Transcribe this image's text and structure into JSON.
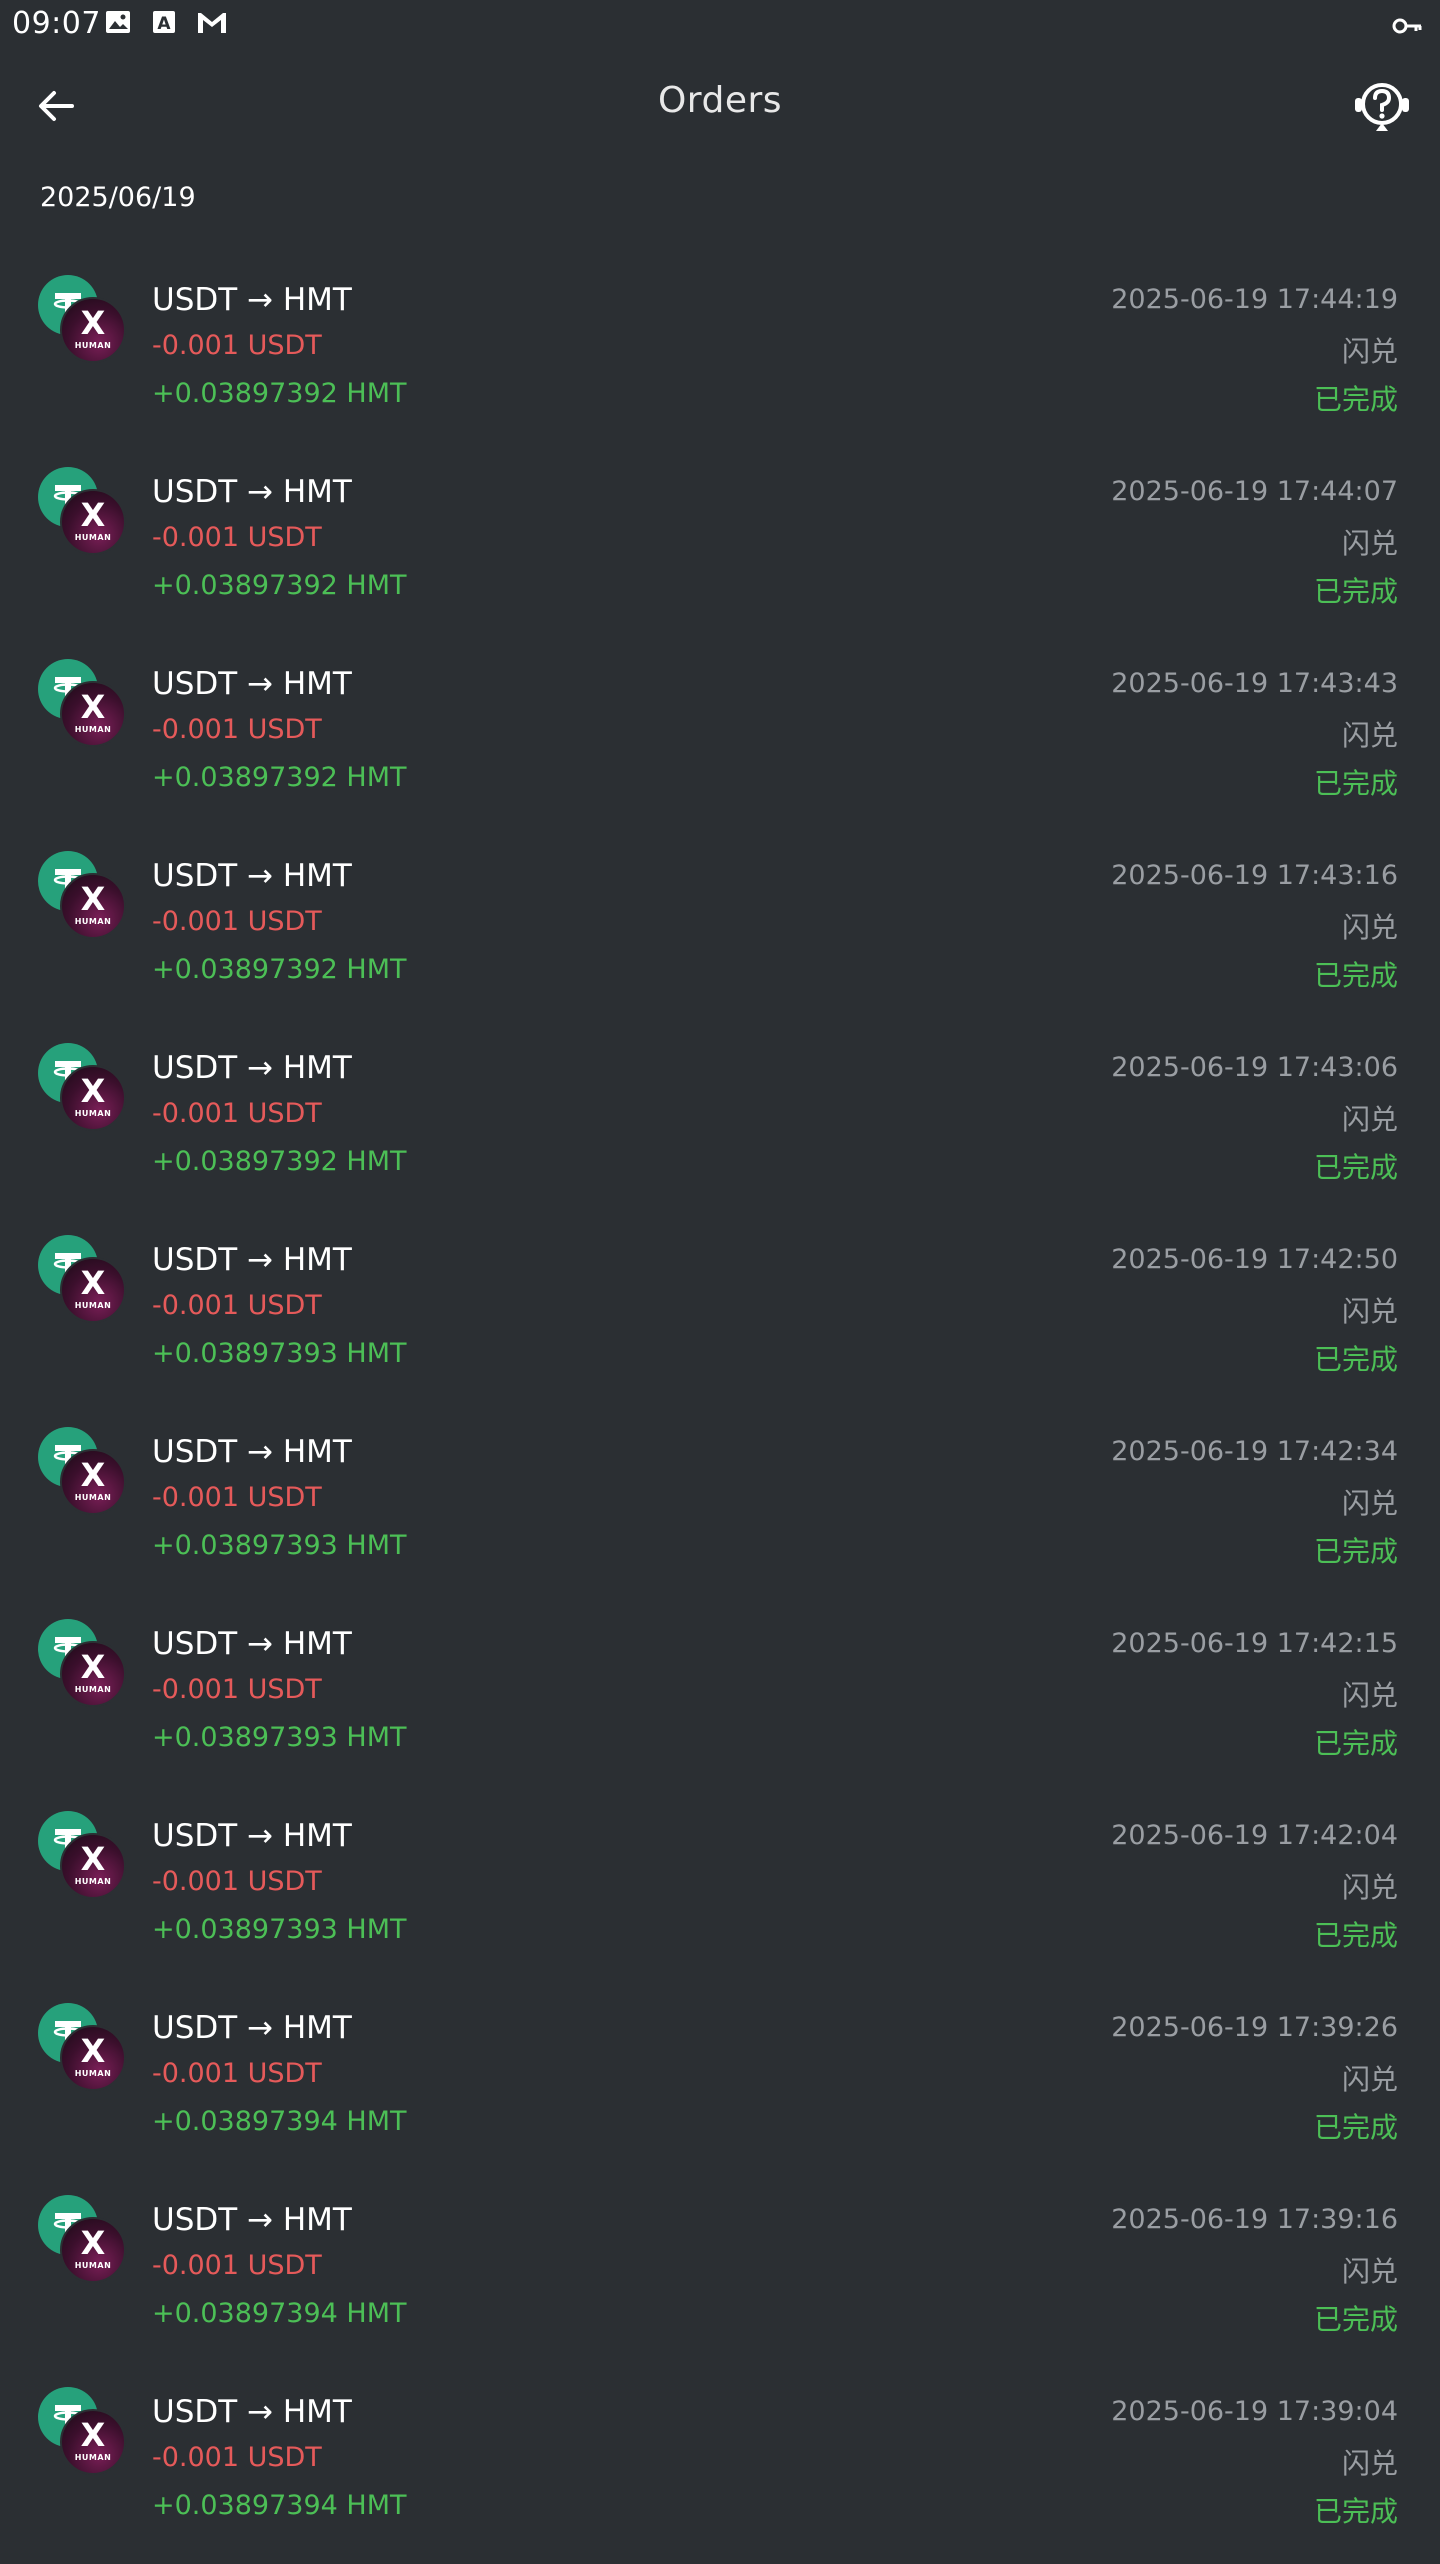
{
  "status_bar": {
    "time": "09:07",
    "icons": [
      "image-icon",
      "text-a-icon",
      "gmail-icon"
    ],
    "right_icon": "key-icon"
  },
  "app_bar": {
    "title": "Orders",
    "back_icon": "arrow-left-icon",
    "help_icon": "help-headset-icon"
  },
  "date_header": "2025/06/19",
  "orders": [
    {
      "pair": "USDT → HMT",
      "amount_out": "-0.001 USDT",
      "amount_in": "+0.03897392 HMT",
      "time": "2025-06-19 17:44:19",
      "type": "闪兑",
      "status": "已完成"
    },
    {
      "pair": "USDT → HMT",
      "amount_out": "-0.001 USDT",
      "amount_in": "+0.03897392 HMT",
      "time": "2025-06-19 17:44:07",
      "type": "闪兑",
      "status": "已完成"
    },
    {
      "pair": "USDT → HMT",
      "amount_out": "-0.001 USDT",
      "amount_in": "+0.03897392 HMT",
      "time": "2025-06-19 17:43:43",
      "type": "闪兑",
      "status": "已完成"
    },
    {
      "pair": "USDT → HMT",
      "amount_out": "-0.001 USDT",
      "amount_in": "+0.03897392 HMT",
      "time": "2025-06-19 17:43:16",
      "type": "闪兑",
      "status": "已完成"
    },
    {
      "pair": "USDT → HMT",
      "amount_out": "-0.001 USDT",
      "amount_in": "+0.03897392 HMT",
      "time": "2025-06-19 17:43:06",
      "type": "闪兑",
      "status": "已完成"
    },
    {
      "pair": "USDT → HMT",
      "amount_out": "-0.001 USDT",
      "amount_in": "+0.03897393 HMT",
      "time": "2025-06-19 17:42:50",
      "type": "闪兑",
      "status": "已完成"
    },
    {
      "pair": "USDT → HMT",
      "amount_out": "-0.001 USDT",
      "amount_in": "+0.03897393 HMT",
      "time": "2025-06-19 17:42:34",
      "type": "闪兑",
      "status": "已完成"
    },
    {
      "pair": "USDT → HMT",
      "amount_out": "-0.001 USDT",
      "amount_in": "+0.03897393 HMT",
      "time": "2025-06-19 17:42:15",
      "type": "闪兑",
      "status": "已完成"
    },
    {
      "pair": "USDT → HMT",
      "amount_out": "-0.001 USDT",
      "amount_in": "+0.03897393 HMT",
      "time": "2025-06-19 17:42:04",
      "type": "闪兑",
      "status": "已完成"
    },
    {
      "pair": "USDT → HMT",
      "amount_out": "-0.001 USDT",
      "amount_in": "+0.03897394 HMT",
      "time": "2025-06-19 17:39:26",
      "type": "闪兑",
      "status": "已完成"
    },
    {
      "pair": "USDT → HMT",
      "amount_out": "-0.001 USDT",
      "amount_in": "+0.03897394 HMT",
      "time": "2025-06-19 17:39:16",
      "type": "闪兑",
      "status": "已完成"
    },
    {
      "pair": "USDT → HMT",
      "amount_out": "-0.001 USDT",
      "amount_in": "+0.03897394 HMT",
      "time": "2025-06-19 17:39:04",
      "type": "闪兑",
      "status": "已完成"
    }
  ],
  "coin_icons": {
    "from": "usdt-icon",
    "to": "hmt-icon",
    "to_letter": "X",
    "to_caption": "HUMAN"
  },
  "colors": {
    "background": "#2b2f33",
    "negative": "#e55a5a",
    "positive": "#4cbf56",
    "muted": "#9a9ea3",
    "usdt": "#26a17b"
  }
}
